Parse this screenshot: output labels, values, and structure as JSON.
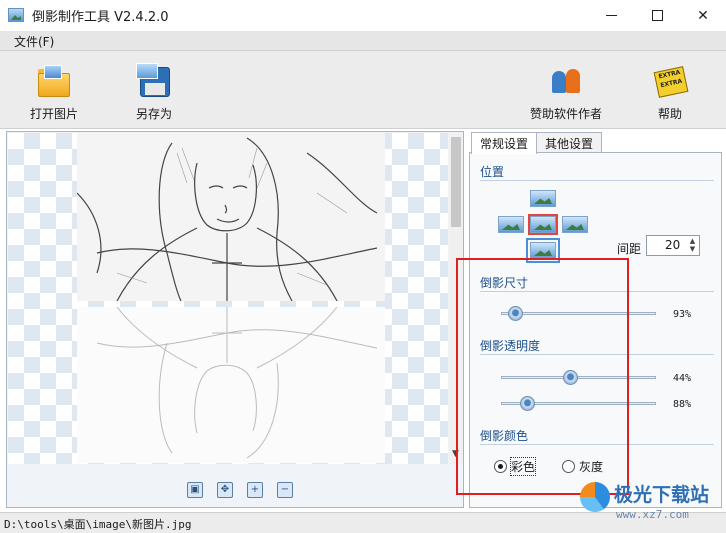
{
  "window": {
    "title": "倒影制作工具 V2.4.2.0",
    "minimize": "minimize",
    "maximize": "maximize",
    "close": "✕"
  },
  "menu": {
    "items": [
      {
        "label": "文件(F)"
      }
    ]
  },
  "toolbar": {
    "open_label": "打开图片",
    "save_as_label": "另存为",
    "donate_label": "赞助软件作者",
    "help_label": "帮助",
    "help_icon_text": "EXTRA EXTRA"
  },
  "tabs": [
    {
      "label": "常规设置",
      "active": true
    },
    {
      "label": "其他设置",
      "active": false
    }
  ],
  "position": {
    "title": "位置",
    "selected": "center",
    "gap_label": "间距",
    "gap_value": "20"
  },
  "reflection_size": {
    "title": "倒影尺寸",
    "value_fraction": 0.03,
    "value_text": "93%"
  },
  "reflection_opacity": {
    "title": "倒影透明度",
    "slider1_fraction": 0.44,
    "slider1_text": "44%",
    "slider2_fraction": 0.12,
    "slider2_text": "88%"
  },
  "reflection_color": {
    "title": "倒影颜色",
    "options": [
      {
        "label": "彩色",
        "checked": true
      },
      {
        "label": "灰度",
        "checked": false
      }
    ]
  },
  "status": {
    "path": "D:\\tools\\桌面\\image\\新图片.jpg"
  },
  "watermark": {
    "brand": "极光下载站",
    "url": "www.xz7.com"
  },
  "colors": {
    "highlight": "#e02020",
    "accent": "#1c4f8c"
  }
}
